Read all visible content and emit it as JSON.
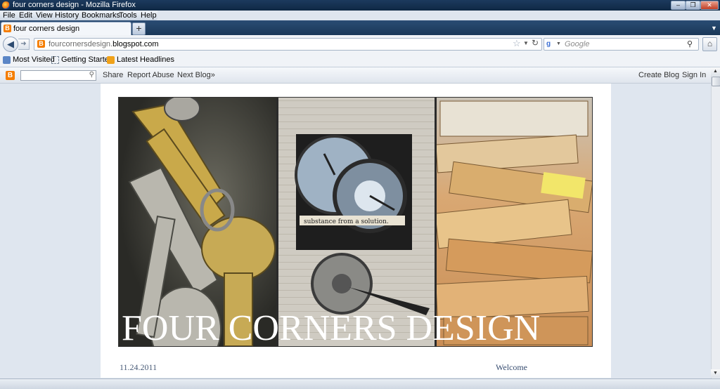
{
  "window": {
    "title": "four corners design - Mozilla Firefox"
  },
  "menubar": {
    "items": [
      "File",
      "Edit",
      "View",
      "History",
      "Bookmarks",
      "Tools",
      "Help"
    ]
  },
  "tabs": [
    {
      "label": "four corners design"
    }
  ],
  "newtab_symbol": "+",
  "navigation": {
    "url_plain": "fourcornersdesign.",
    "url_domain": "blogspot.com",
    "search_engine": "Google",
    "search_placeholder": "Google"
  },
  "bookmarks": [
    "Most Visited",
    "Getting Started",
    "Latest Headlines"
  ],
  "blogger_navbar": {
    "left_links": [
      "Share",
      "Report Abuse",
      "Next Blog»"
    ],
    "right_links": [
      "Create Blog",
      "Sign In"
    ]
  },
  "blog": {
    "title": "FOUR CORNERS DESIGN",
    "header_caption": "substance from a solution.",
    "post_date": "11.24.2011",
    "sidebar_heading": "Welcome"
  },
  "colors": {
    "titlebar": "#1c3a5e",
    "blogger_orange": "#f57d00",
    "page_bg": "#dfe6ef"
  },
  "icons": [
    "firefox-logo-icon",
    "blogger-icon",
    "back-arrow-icon",
    "forward-arrow-icon",
    "star-icon",
    "reload-icon",
    "google-icon",
    "search-icon",
    "home-icon",
    "rss-icon",
    "page-icon"
  ]
}
